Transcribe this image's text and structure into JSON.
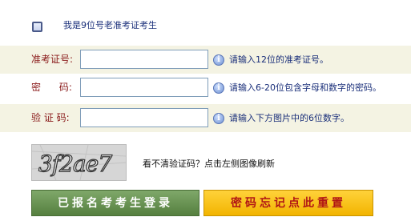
{
  "checkbox": {
    "label": "我是9位号老准考证考生",
    "checked": false
  },
  "fields": [
    {
      "label": "准考证号:",
      "value": "",
      "hint": "请输入12位的准考证号。"
    },
    {
      "label": "密      码:",
      "value": "",
      "hint": "请输入6-20位包含字母和数字的密码。"
    },
    {
      "label": "验 证 码:",
      "value": "",
      "hint": "请输入下方图片中的6位数字。"
    }
  ],
  "captcha": {
    "text": "3f2ae7",
    "refresh_hint": "看不清验证码？点击左侧图像刷新"
  },
  "buttons": {
    "login": "已报名考考生登录",
    "reset": "密码忘记点此重置"
  },
  "colors": {
    "label": "#8a1a1a",
    "hint": "#1a2f7a",
    "row_shade": "#f4f3e3",
    "login_bg": "#6a9655",
    "reset_bg": "#f7c21b",
    "reset_text": "#b01515"
  }
}
